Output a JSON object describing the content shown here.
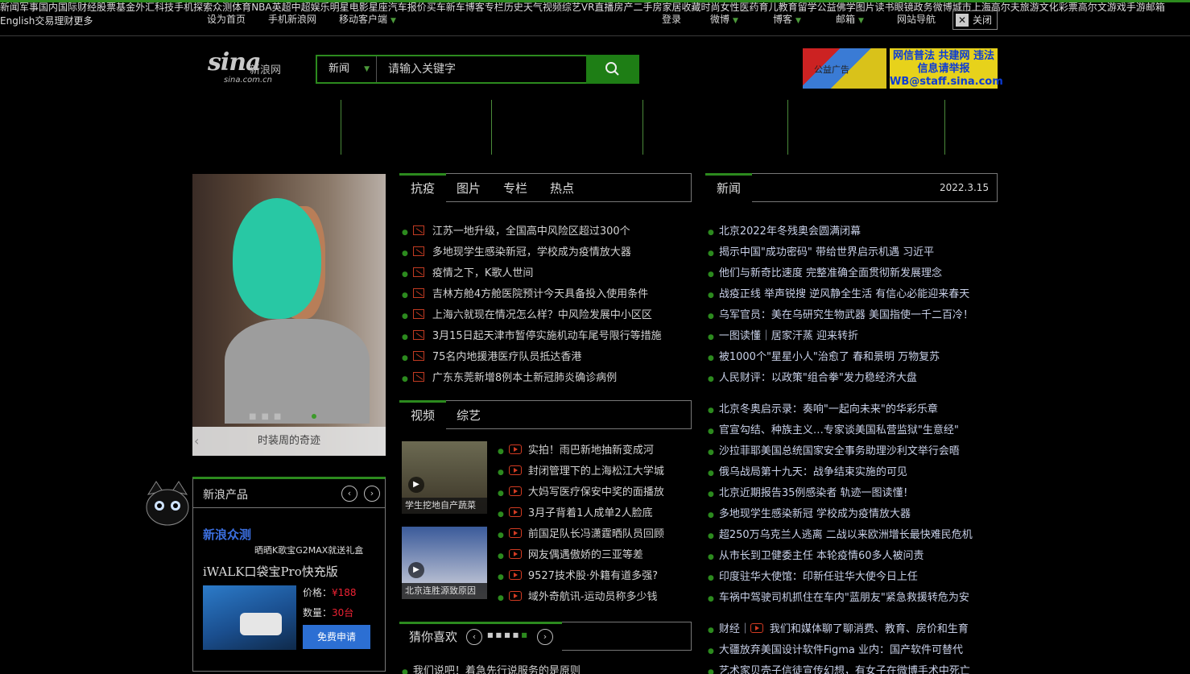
{
  "topbar": {
    "left": [
      "设为首页",
      "手机新浪网",
      "移动客户端"
    ],
    "right": [
      "登录",
      "微博",
      "博客",
      "邮箱",
      "网站导航"
    ],
    "close": "关闭"
  },
  "header": {
    "logo_text": "sina",
    "logo_cn": "新浪网",
    "logo_url": "sina.com.cn",
    "search_select": "新闻",
    "search_placeholder": "请输入关键字",
    "ad1_text": "公益广告",
    "ad2_text": "网信普法 共建网 违法信息请举报 WB@staff.sina.com"
  },
  "nav": {
    "groups": [
      [
        [
          "新闻",
          "军事",
          "国内",
          "国际"
        ],
        [
          "财经",
          "股票",
          "基金",
          "外汇"
        ],
        [
          "科技",
          "手机",
          "探索",
          "众测"
        ]
      ],
      [
        [
          "体育",
          "NBA",
          "英超",
          "中超"
        ],
        [
          "娱乐",
          "明星",
          "电影",
          "星座"
        ],
        [
          "汽车",
          "报价",
          "买车",
          "新车"
        ]
      ],
      [
        [
          "博客",
          "专栏",
          "历史",
          "天气"
        ],
        [
          "视频",
          "综艺",
          "VR",
          "直播"
        ],
        [
          "房产",
          "二手房",
          "家居",
          "收藏"
        ]
      ],
      [
        [
          "时尚",
          "女性",
          "医药",
          "育儿"
        ],
        [
          "教育",
          "留学",
          "公益",
          "佛学"
        ],
        [
          "图片",
          "读书",
          "眼镜",
          "政务"
        ]
      ],
      [
        [
          "微博",
          "城市",
          "上海",
          "高尔夫"
        ],
        [
          "旅游",
          "文化",
          "彩票",
          "高尔文"
        ],
        [
          "游戏",
          "手游",
          "邮箱",
          "English"
        ]
      ],
      [
        [
          "交易"
        ],
        [
          "理财"
        ],
        [
          "更多"
        ]
      ]
    ]
  },
  "slider": {
    "caption": "时装周的奇迹"
  },
  "newprod": {
    "title": "新浪产品",
    "sub_title": "新浪众测",
    "sub_line": "晒晒K歌宝G2MAX就送礼盒",
    "product": "iWALK口袋宝Pro快充版",
    "price_label": "价格：",
    "price": "¥188",
    "qty_label": "数量：",
    "qty": "30台",
    "apply": "免费申请"
  },
  "mid_tabs": {
    "active": "抗疫",
    "tabs": [
      "图片",
      "专栏",
      "热点"
    ]
  },
  "mid_news": [
    "江苏一地升级，全国高中风险区超过300个",
    "多地现学生感染新冠，学校成为疫情放大器",
    "疫情之下，K歌人世间",
    "吉林方舱4方舱医院预计今天具备投入使用条件",
    "上海六就现在情况怎么样？中风险发展中小区区",
    "3月15日起天津市暂停实施机动车尾号限行等措施",
    "75名内地援港医疗队员抵达香港",
    "广东东莞新增8例本土新冠肺炎确诊病例"
  ],
  "video_tabs": {
    "active": "视频",
    "tabs": [
      "综艺"
    ]
  },
  "videos": [
    {
      "caption": "学生挖地自产蔬菜"
    },
    {
      "caption": "北京连胜源致原因"
    }
  ],
  "video_news": [
    "实拍！雨巴新地抽新变成河",
    "封闭管理下的上海松江大学城",
    "大妈写医疗保安中奖的面播放",
    "3月子背着1人成单2人脸底",
    "前国足队长冯潇霆晒队员回顾",
    "网友偶遇傲娇的三亚等差",
    "9527技术股·外籍有道多强?",
    "域外奇航讯-运动员称多少钱"
  ],
  "guess": {
    "title": "猜你喜欢"
  },
  "bottom_mid_news": "我们说吧！着急先行说服务的是原则",
  "right_tabs": {
    "active": "新闻",
    "date": "2022.3.15"
  },
  "right_news": [
    "北京2022年冬残奥会圆满闭幕",
    "揭示中国\"成功密码\" 带给世界启示机遇 习近平",
    "他们与新奇比速度 完整准确全面贯彻新发展理念",
    "战疫正线 举声锐搜 逆风静全生活 有信心必能迎来春天",
    "乌军官员：美在乌研究生物武器 美国指使一千二百冷！",
    "一图读懂｜居家汗蒸 迎来转折",
    "被1000个\"星星小人\"治愈了 春和景明 万物复苏",
    "人民财评：以政策\"组合拳\"发力稳经济大盘"
  ],
  "right_news2": [
    "北京冬奥启示录：奏响\"一起向未来\"的华彩乐章",
    "官宣勾结、种族主义…专家谈美国私营监狱\"生意经\"",
    "沙拉菲耶美国总统国家安全事务助理沙利文举行会晤",
    "俄乌战局第十九天：战争结束实施的可见",
    "北京近期报告35例感染者 轨迹一图读懂！",
    "多地现学生感染新冠 学校成为疫情放大器",
    "超250万乌克兰人逃离 二战以来欧洲增长最快难民危机",
    "从市长到卫健委主任 本轮疫情60多人被问责",
    "印度驻华大使馆：印新任驻华大使今日上任",
    "车祸中驾驶司机抓住在车内\"蓝朋友\"紧急救援转危为安"
  ],
  "right_news3_prefix": "财经｜",
  "right_news3": [
    "我们和媒体聊了聊消费、教育、房价和生育",
    "大疆放弃美国设计软件Figma 业内：国产软件可替代",
    "艺术家贝壳子信徒宣传幻想，有女子在微博手术中死亡"
  ]
}
